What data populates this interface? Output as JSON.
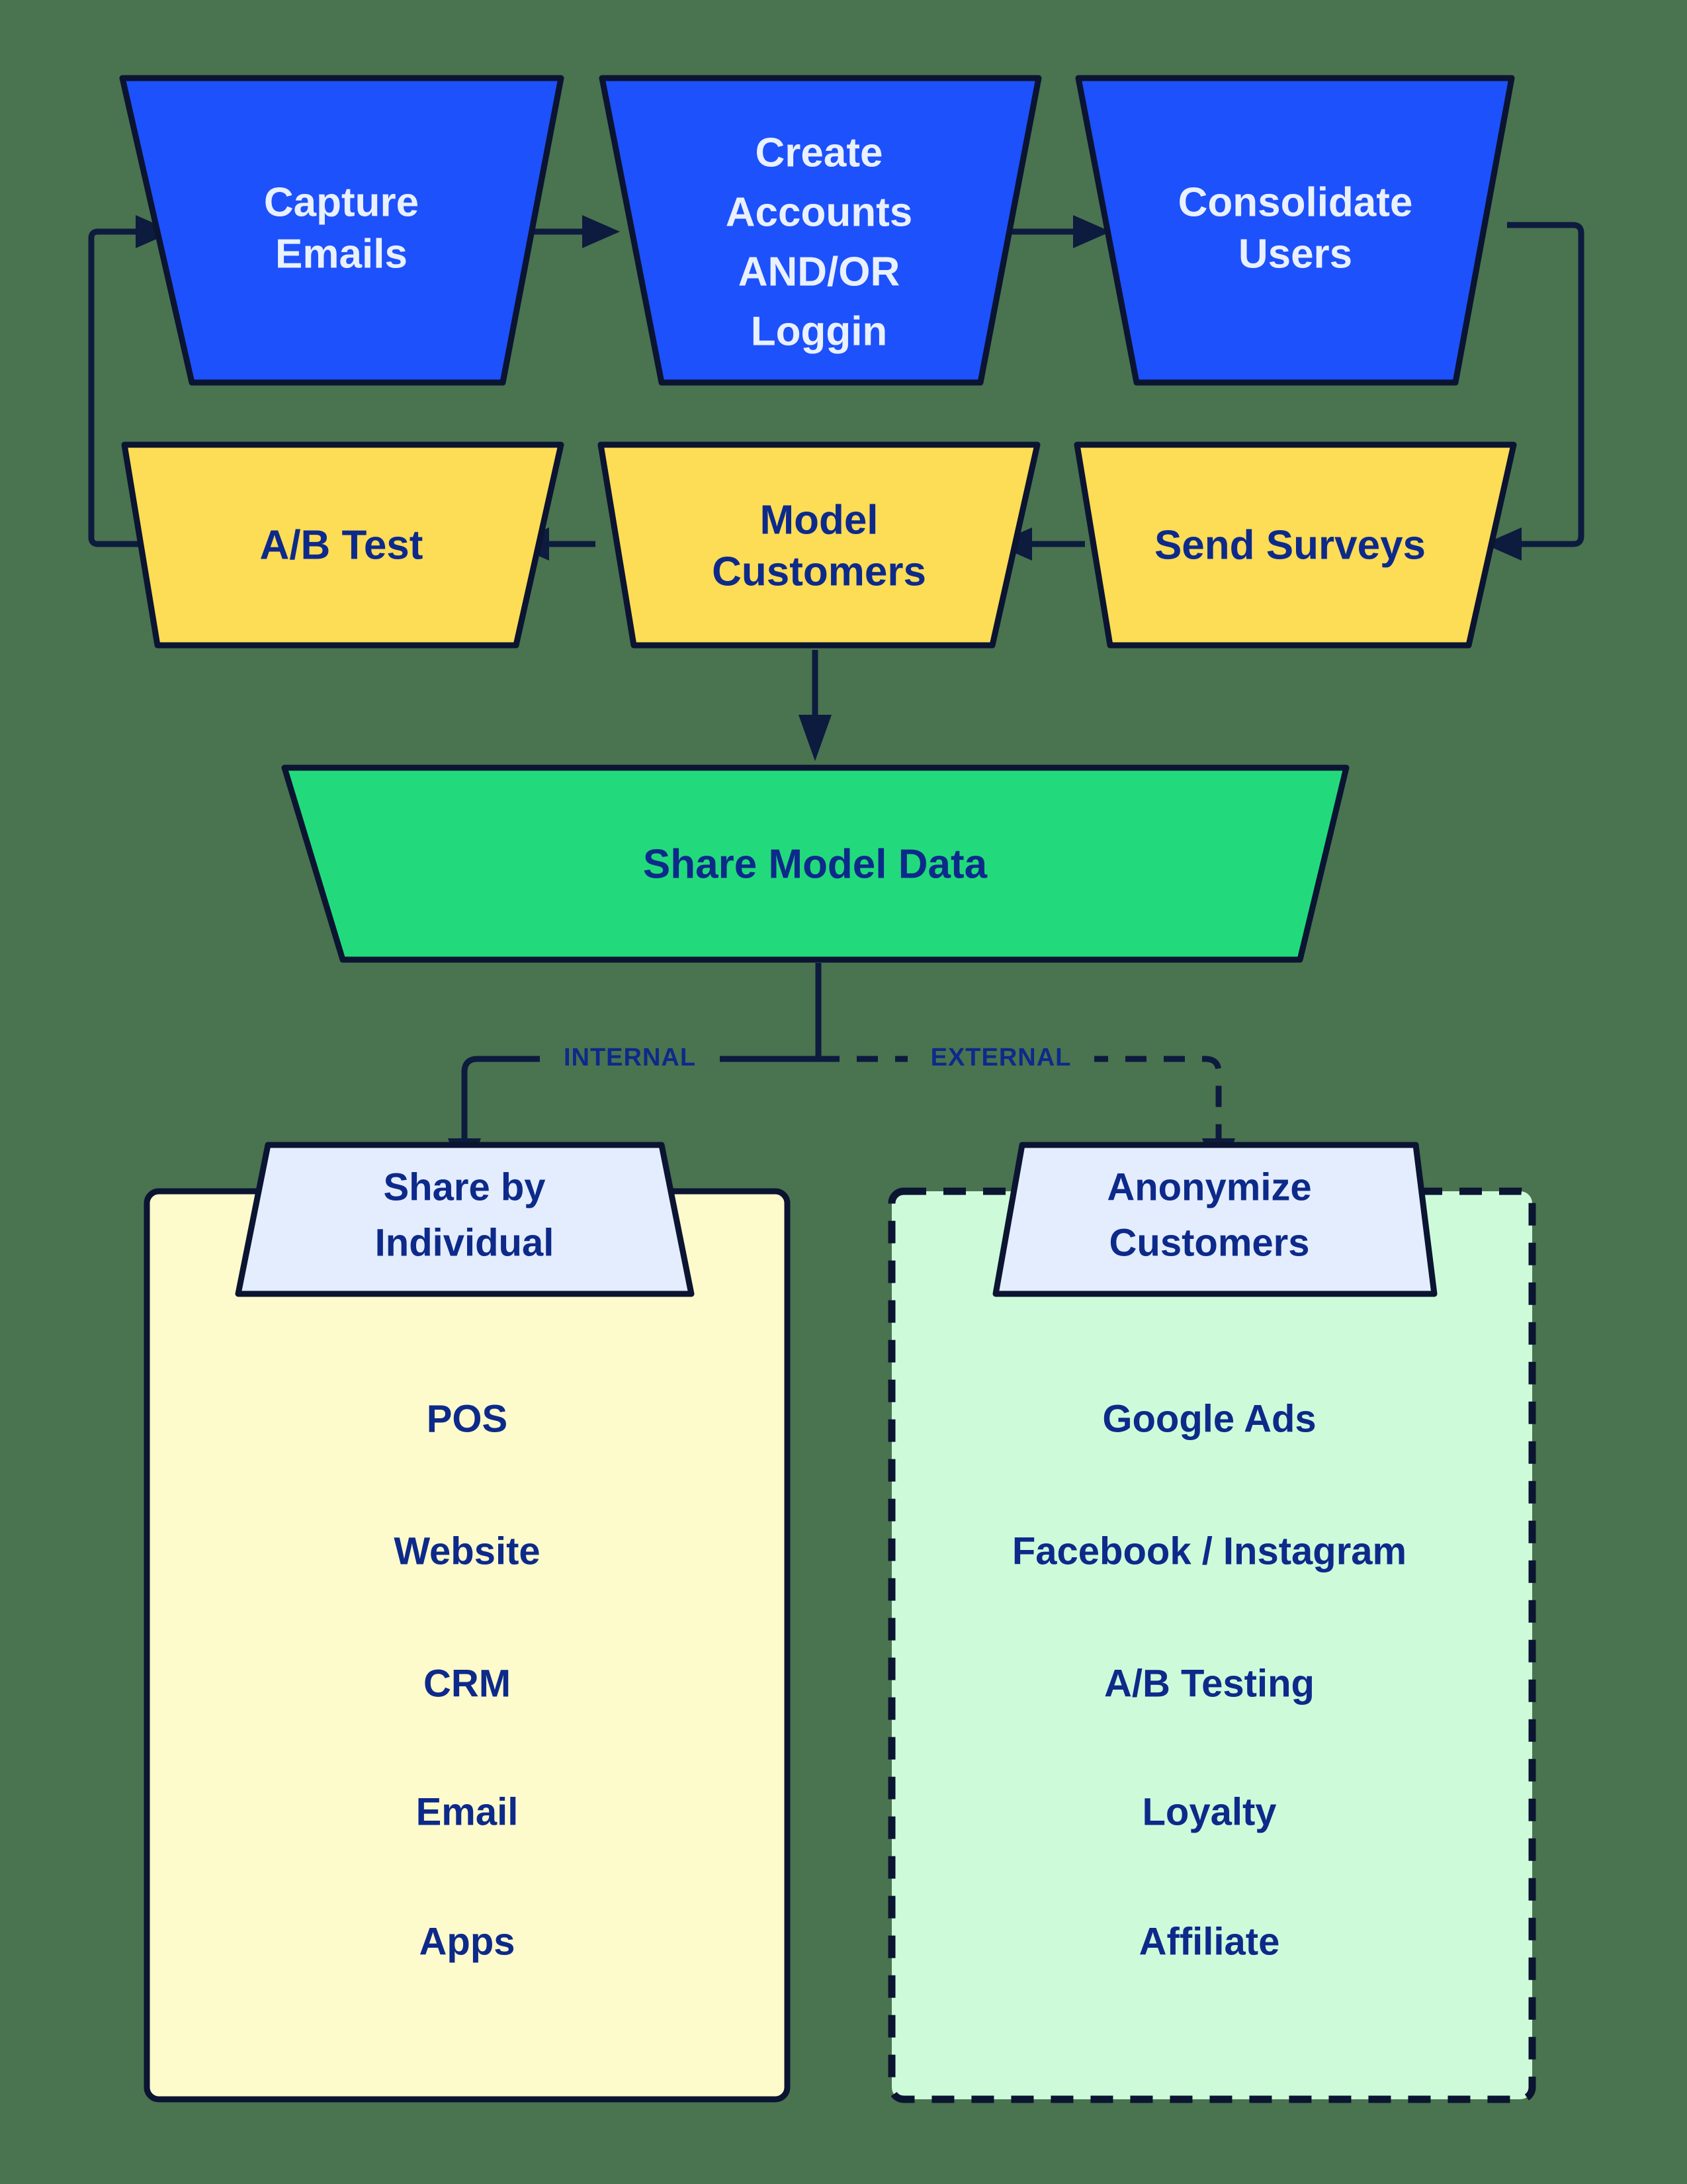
{
  "colors": {
    "background": "#4a7350",
    "stage_blue": "#1d51fc",
    "stage_blue_text": "#e9f0fe",
    "stage_yellow": "#fddc56",
    "stage_green": "#22da7c",
    "node_text_dark": "#0d2a8a",
    "subnode_fill": "#e3edfd",
    "panel_internal_fill": "#fdfacc",
    "panel_external_fill": "#cdfbda",
    "stroke": "#0b1431",
    "connector": "#0d1b3e"
  },
  "flow": {
    "row_collect": [
      {
        "id": "capture-emails",
        "label": "Capture Emails",
        "lines": [
          "Capture",
          "Emails"
        ]
      },
      {
        "id": "create-accounts",
        "label": "Create Accounts AND/OR Loggin",
        "lines": [
          "Create",
          "Accounts",
          "AND/OR",
          "Loggin"
        ]
      },
      {
        "id": "consolidate-users",
        "label": "Consolidate Users",
        "lines": [
          "Consolidate",
          "Users"
        ]
      }
    ],
    "row_analyze": [
      {
        "id": "ab-test",
        "label": "A/B Test",
        "lines": [
          "A/B Test"
        ]
      },
      {
        "id": "model-customers",
        "label": "Model Customers",
        "lines": [
          "Model",
          "Customers"
        ]
      },
      {
        "id": "send-surveys",
        "label": "Send Surveys",
        "lines": [
          "Send Surveys"
        ]
      }
    ],
    "hub": {
      "id": "share-model-data",
      "label": "Share Model Data",
      "lines": [
        "Share Model Data"
      ]
    },
    "branch_labels": {
      "internal": "INTERNAL",
      "external": "EXTERNAL"
    }
  },
  "branches": {
    "internal": {
      "header": {
        "id": "share-by-individual",
        "label": "Share by Individual",
        "lines": [
          "Share by",
          "Individual"
        ]
      },
      "items": [
        "POS",
        "Website",
        "CRM",
        "Email",
        "Apps"
      ]
    },
    "external": {
      "header": {
        "id": "anonymize-customers",
        "label": "Anonymize Customers",
        "lines": [
          "Anonymize",
          "Customers"
        ]
      },
      "items": [
        "Google Ads",
        "Facebook / Instagram",
        "A/B Testing",
        "Loyalty",
        "Affiliate"
      ]
    }
  }
}
